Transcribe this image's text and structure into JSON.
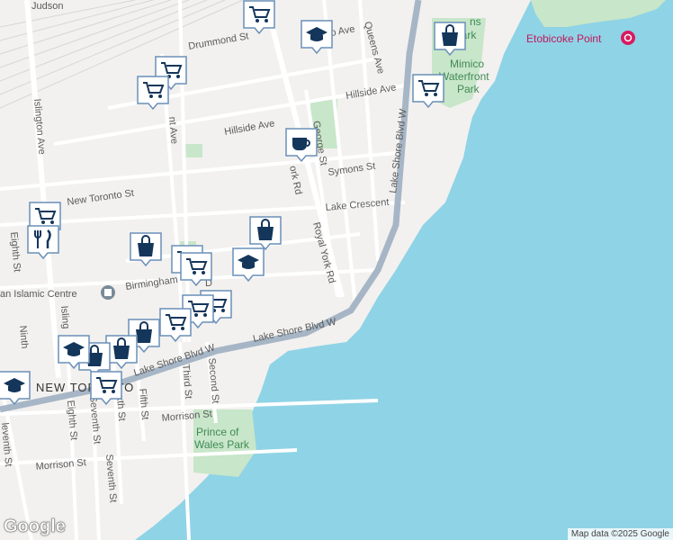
{
  "map": {
    "colors": {
      "land": "#f2f1ef",
      "water": "#8fd3e6",
      "park": "#c8e6c9",
      "road": "#ffffff",
      "highway": "#a7b6c6",
      "rail": "#c7c7c7"
    },
    "labels": {
      "judson": "Judson",
      "drummond": "Drummond St",
      "oneida": "o Ave",
      "queens": "Queens Ave",
      "hillside_e": "Hillside Ave",
      "hillside_w": "Hillside Ave",
      "islington": "Islington Ave",
      "new_toronto_st": "New Toronto St",
      "symons": "Symons St",
      "george": "George St",
      "york_upper": "ork Rd",
      "lake_crescent": "Lake Crescent",
      "lake_shore_vert": "Lake Shore Blvd W",
      "royal_york": "Royal York Rd",
      "eighth_upper": "Eighth St",
      "birmingham": "Birmingham",
      "islamic": "an Islamic Centre",
      "lake_shore_main": "Lake Shore Blvd W",
      "lake_shore_left": "Lake Shore Blvd W",
      "ninth": "Ninth",
      "isling_short": "Isling",
      "new_toronto_area": "NEW TORONTO",
      "third": "Third St",
      "second": "Second St",
      "fifth": "Fifth St",
      "sixth": "xth St",
      "morrison_e": "Morrison St",
      "morrison_w": "Morrison St",
      "eighth_lower": "Eighth St",
      "seventh_a": "Seventh St",
      "seventh_b": "Seventh St",
      "eleventh": "leventh St",
      "prince_wales_1": "Prince of",
      "prince_wales_2": "Wales Park",
      "etobicoke_point": "Etobicoke Point",
      "mimico_1": "Mimico",
      "mimico_2": "Waterfront",
      "mimico_3": "Park",
      "humber_park_partial": "ns",
      "humber_park_partial2": "W     Park",
      "dr": "D",
      "nt_ave": "nt Ave"
    },
    "markers": [
      {
        "type": "shopping-cart-icon"
      },
      {
        "type": "school-icon"
      },
      {
        "type": "shopping-bag-icon"
      },
      {
        "type": "shopping-cart-icon"
      },
      {
        "type": "shopping-cart-icon"
      },
      {
        "type": "shopping-cart-icon"
      },
      {
        "type": "cafe-icon"
      },
      {
        "type": "shopping-cart-icon"
      },
      {
        "type": "restaurant-icon"
      },
      {
        "type": "shopping-bag-icon"
      },
      {
        "type": "shopping-bag-icon"
      },
      {
        "type": "school-icon"
      },
      {
        "type": "shopping-cart-icon"
      },
      {
        "type": "shopping-cart-icon"
      },
      {
        "type": "shopping-cart-icon"
      },
      {
        "type": "shopping-cart-icon"
      },
      {
        "type": "shopping-cart-icon"
      },
      {
        "type": "shopping-bag-icon"
      },
      {
        "type": "shopping-bag-icon"
      },
      {
        "type": "shopping-bag-icon"
      },
      {
        "type": "school-icon"
      },
      {
        "type": "school-icon"
      },
      {
        "type": "shopping-cart-icon"
      }
    ],
    "attribution": "Map data ©2025 Google",
    "logo": "Google"
  }
}
